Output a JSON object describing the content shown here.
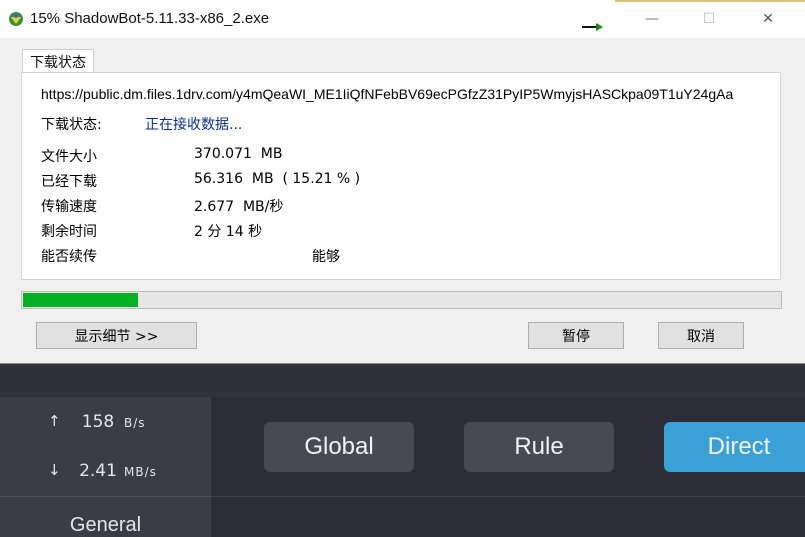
{
  "window": {
    "title": "15% ShadowBot-5.11.33-x86_2.exe",
    "controls": {
      "minimize": "—",
      "maximize": "☐",
      "close": "✕"
    }
  },
  "tab": {
    "label": "下载状态"
  },
  "download": {
    "url": "https://public.dm.files.1drv.com/y4mQeaWI_ME1IiQfNFebBV69ecPGfzZ31PyIP5WmyjsHASCkpa09T1uY24gAa",
    "status_label": "下载状态:",
    "status_value": "正在接收数据...",
    "rows": [
      {
        "label": "文件大小",
        "value": "370.071  MB"
      },
      {
        "label": "已经下载",
        "value": "56.316  MB  ( 15.21 % )"
      },
      {
        "label": "传输速度",
        "value": "2.677  MB/秒"
      },
      {
        "label": "剩余时间",
        "value": "2 分 14 秒"
      },
      {
        "label": "能否续传",
        "value": "能够"
      }
    ],
    "progress_percent": 15.21
  },
  "buttons": {
    "details": "显示细节 >>",
    "pause": "暂停",
    "cancel": "取消"
  },
  "background_app": {
    "upload": {
      "arrow": "↑",
      "value": "158",
      "unit": "B/s"
    },
    "download": {
      "arrow": "↓",
      "value": "2.41",
      "unit": "MB/s"
    },
    "sidebar_general": "General",
    "modes": [
      {
        "label": "Global",
        "active": false
      },
      {
        "label": "Rule",
        "active": false
      },
      {
        "label": "Direct",
        "active": true
      }
    ],
    "colors": {
      "active_mode": "#3aa0d6",
      "progress": "#06b025"
    }
  }
}
